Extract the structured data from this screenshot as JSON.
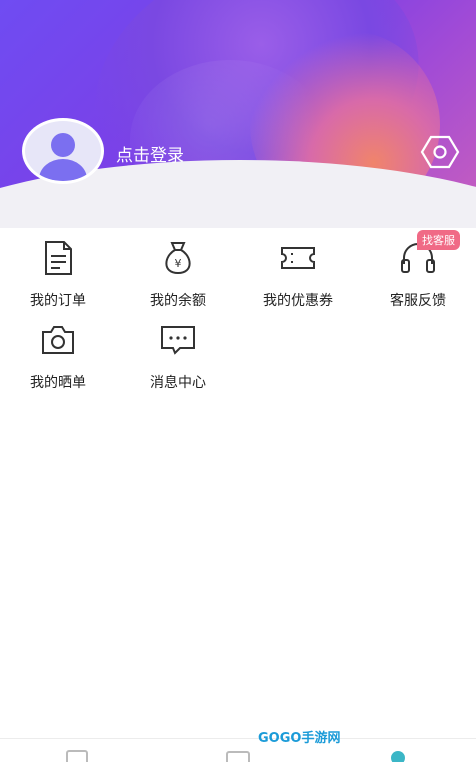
{
  "header": {
    "login_text": "点击登录",
    "colors": {
      "top": "#6f4cf2",
      "accent": "#c85fbd",
      "orange": "#f0846b"
    }
  },
  "menu": {
    "row1": [
      {
        "label": "我的订单",
        "icon": "document-icon"
      },
      {
        "label": "我的余额",
        "icon": "money-bag-icon"
      },
      {
        "label": "我的优惠券",
        "icon": "coupon-icon"
      },
      {
        "label": "客服反馈",
        "icon": "headphones-icon"
      }
    ],
    "row2": [
      {
        "label": "我的晒单",
        "icon": "camera-icon"
      },
      {
        "label": "消息中心",
        "icon": "chat-icon"
      }
    ],
    "badge": "找客服"
  },
  "watermark": "GOGO手游网"
}
